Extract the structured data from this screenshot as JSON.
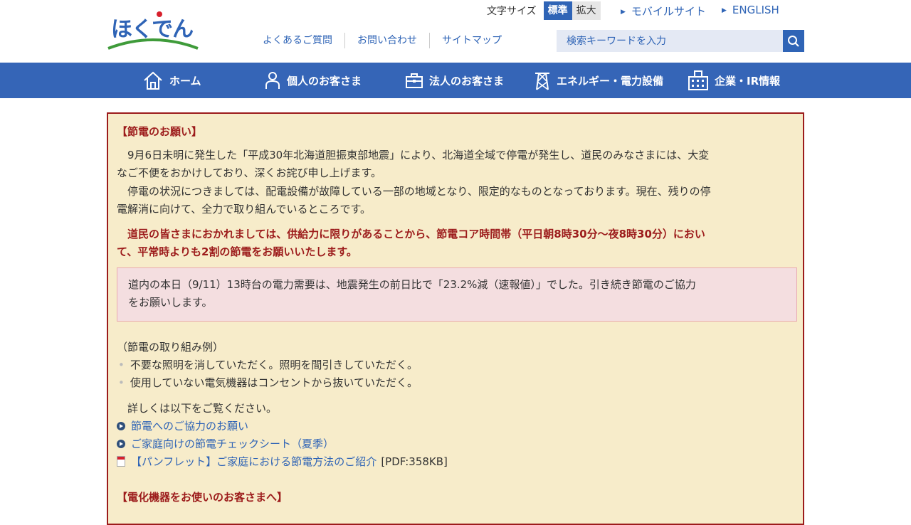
{
  "header": {
    "logo_text": "ほくでん",
    "font_size": {
      "label": "文字サイズ",
      "standard": "標準",
      "large": "拡大"
    },
    "mobile_link": "モバイルサイト",
    "english_link": "ENGLISH",
    "util_nav": [
      "よくあるご質問",
      "お問い合わせ",
      "サイトマップ"
    ],
    "search_placeholder": "検索キーワードを入力"
  },
  "gnav": {
    "home": "ホーム",
    "personal": "個人のお客さま",
    "business": "法人のお客さま",
    "energy": "エネルギー・電力設備",
    "corporate": "企業・IR情報"
  },
  "notice": {
    "title": "【節電のお願い】",
    "para1_line1": "　9月6日未明に発生した「平成30年北海道胆振東部地震」により、北海道全域で停電が発生し、道民のみなさまには、大変",
    "para1_line2": "なご不便をおかけしており、深くお詫び申し上げます。",
    "para2_line1": "　停電の状況につきましては、配電設備が故障している一部の地域となり、限定的なものとなっております。現在、残りの停",
    "para2_line2": "電解消に向けて、全力で取り組んでいるところです。",
    "request_line1": "　道民の皆さまにおかれましては、供給力に限りがあることから、節電コア時間帯（平日朝8時30分～夜8時30分）におい",
    "request_line2": "て、平常時よりも2割の節電をお願いいたします。",
    "demand_line1": "道内の本日（9/11）13時台の電力需要は、地震発生の前日比で「23.2%減（速報値）」でした。引き続き節電のご協力",
    "demand_line2": "をお願いします。",
    "examples_title": "（節電の取り組み例）",
    "examples": [
      "不要な照明を消していただく。照明を間引きしていただく。",
      "使用していない電気機器はコンセントから抜いていただく。"
    ],
    "details_intro": "　詳しくは以下をご覧ください。",
    "links": [
      "節電へのご協力のお願い",
      "ご家庭向けの節電チェックシート（夏季）",
      "【パンフレット】ご家庭における節電方法のご紹介"
    ],
    "pdf_size": "[PDF:358KB]",
    "section2_title": "【電化機器をお使いのお客さまへ】"
  }
}
